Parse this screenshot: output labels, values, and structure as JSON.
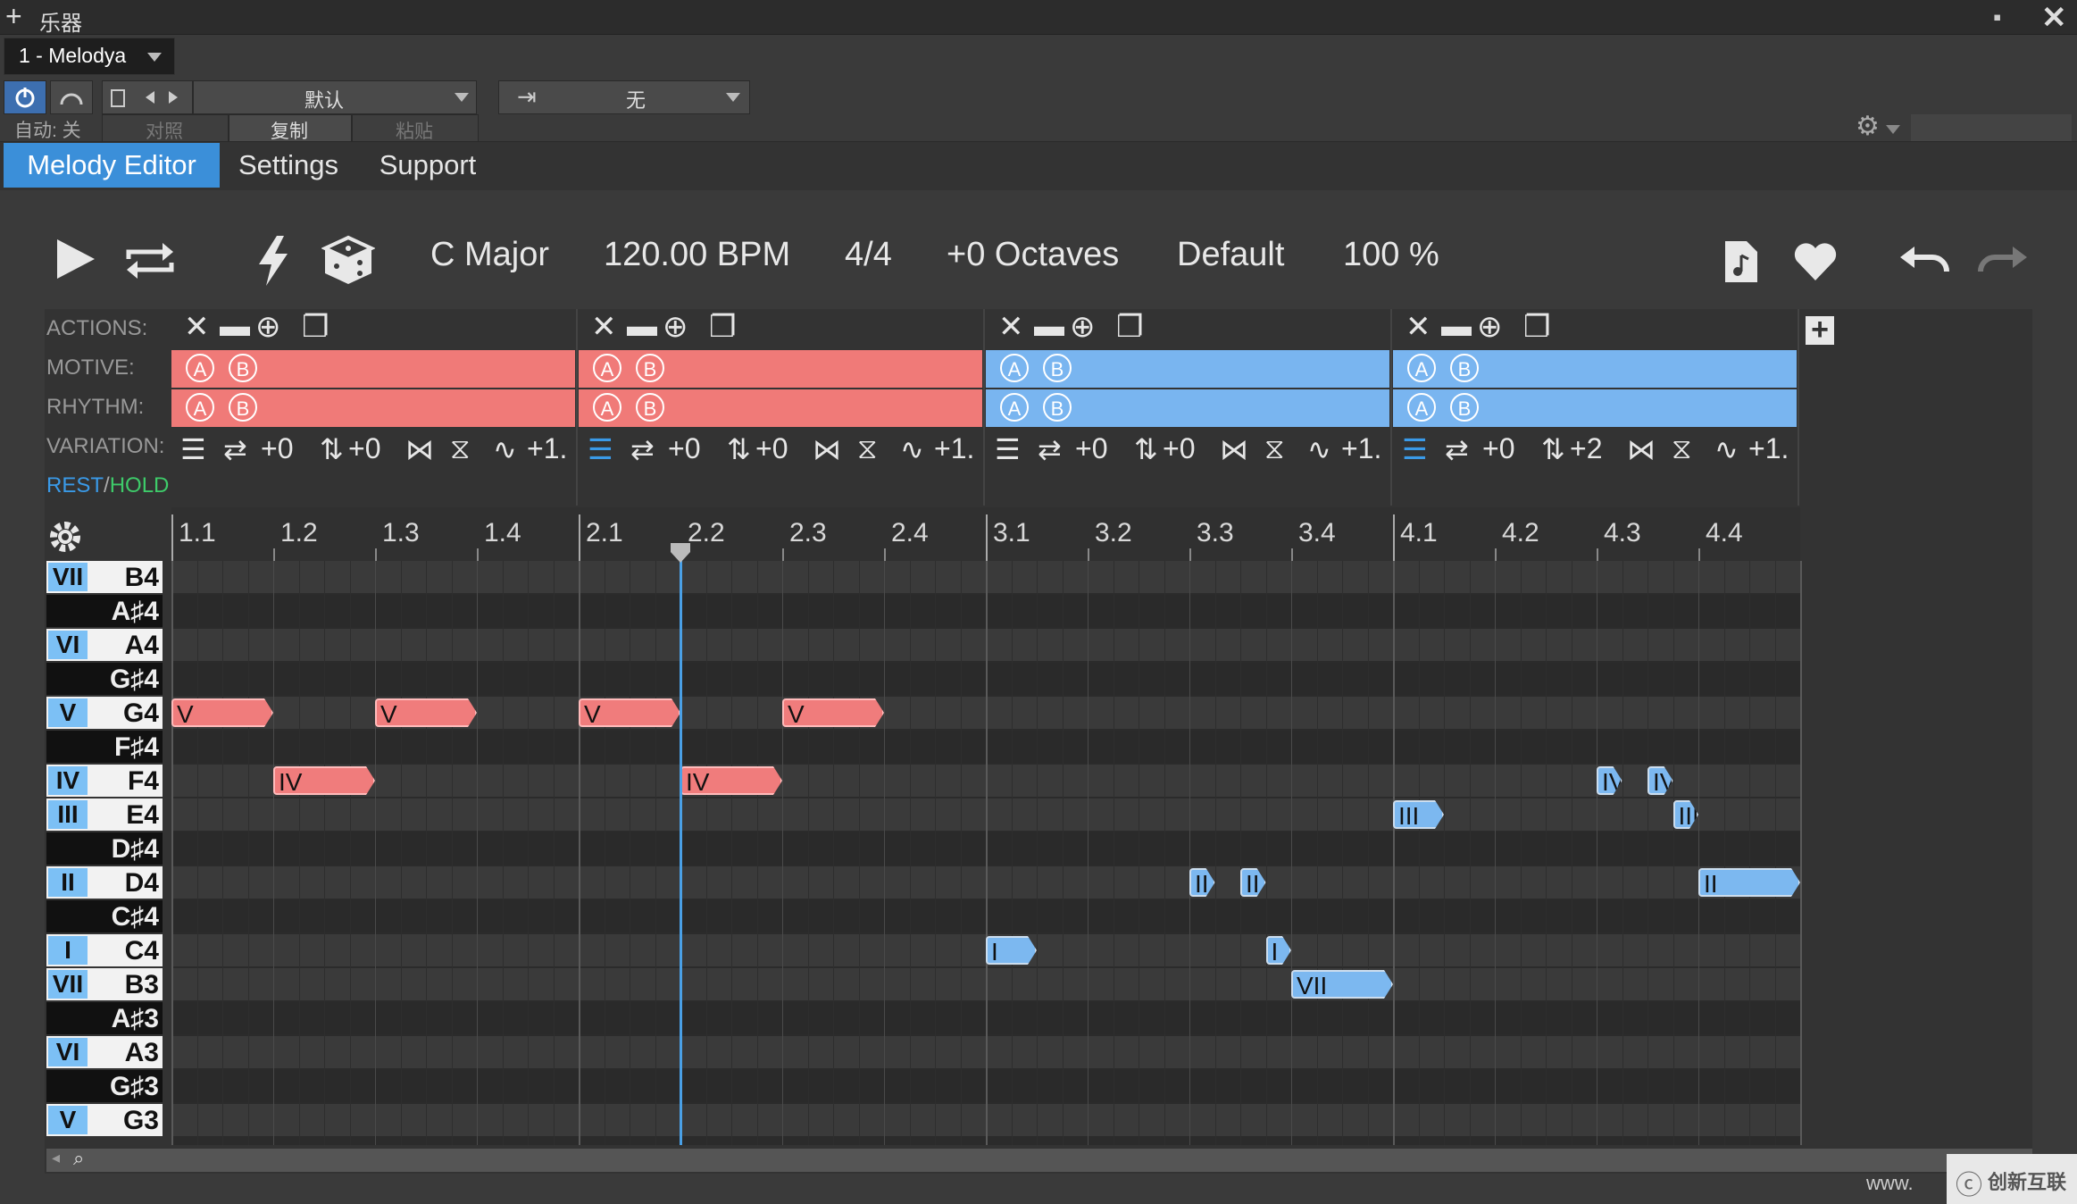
{
  "window": {
    "title": "乐器",
    "plus": "+",
    "pin": "▪",
    "close": "✕"
  },
  "instrument": {
    "name": "1 - Melodya"
  },
  "toolbar": {
    "preset": "默认",
    "routing": "无",
    "auto": "自动: 关",
    "compare": "对照",
    "copy": "复制",
    "paste": "粘贴"
  },
  "tabs": [
    {
      "label": "Melody Editor",
      "active": true
    },
    {
      "label": "Settings"
    },
    {
      "label": "Support"
    }
  ],
  "transport": {
    "key": "C Major",
    "bpm": "120.00 BPM",
    "time_sig": "4/4",
    "octaves": "+0 Octaves",
    "style": "Default",
    "zoom": "100 %"
  },
  "rows": {
    "actions": "ACTIONS:",
    "motive": "MOTIVE:",
    "rhythm": "RHYTHM:",
    "variation": "VARIATION:",
    "rest": "REST",
    "slash": "/",
    "hold": "HOLD"
  },
  "ab": {
    "a": "A",
    "b": "B"
  },
  "segments": [
    {
      "color": "#f07a78",
      "var": [
        "+0",
        "+0",
        "+1."
      ]
    },
    {
      "color": "#f07a78",
      "var": [
        "+0",
        "+0",
        "+1."
      ]
    },
    {
      "color": "#79b5f0",
      "var": [
        "+0",
        "+0",
        "+1."
      ]
    },
    {
      "color": "#79b5f0",
      "var": [
        "+0",
        "+2",
        "+1."
      ]
    }
  ],
  "ruler": [
    "1.1",
    "1.2",
    "1.3",
    "1.4",
    "2.1",
    "2.2",
    "2.3",
    "2.4",
    "3.1",
    "3.2",
    "3.3",
    "3.4",
    "4.1",
    "4.2",
    "4.3",
    "4.4"
  ],
  "keys": [
    {
      "deg": "VII",
      "note": "B4",
      "black": false
    },
    {
      "deg": "",
      "note": "A♯4",
      "black": true
    },
    {
      "deg": "VI",
      "note": "A4",
      "black": false
    },
    {
      "deg": "",
      "note": "G♯4",
      "black": true
    },
    {
      "deg": "V",
      "note": "G4",
      "black": false
    },
    {
      "deg": "",
      "note": "F♯4",
      "black": true
    },
    {
      "deg": "IV",
      "note": "F4",
      "black": false
    },
    {
      "deg": "III",
      "note": "E4",
      "black": false
    },
    {
      "deg": "",
      "note": "D♯4",
      "black": true
    },
    {
      "deg": "II",
      "note": "D4",
      "black": false
    },
    {
      "deg": "",
      "note": "C♯4",
      "black": true
    },
    {
      "deg": "I",
      "note": "C4",
      "black": false
    },
    {
      "deg": "VII",
      "note": "B3",
      "black": false
    },
    {
      "deg": "",
      "note": "A♯3",
      "black": true
    },
    {
      "deg": "VI",
      "note": "A3",
      "black": false
    },
    {
      "deg": "",
      "note": "G♯3",
      "black": true
    },
    {
      "deg": "V",
      "note": "G3",
      "black": false
    }
  ],
  "notes": [
    {
      "label": "V",
      "row": 4,
      "start": 0,
      "len": 4,
      "color": "red"
    },
    {
      "label": "V",
      "row": 4,
      "start": 8,
      "len": 4,
      "color": "red"
    },
    {
      "label": "V",
      "row": 4,
      "start": 16,
      "len": 4,
      "color": "red"
    },
    {
      "label": "V",
      "row": 4,
      "start": 24,
      "len": 4,
      "color": "red"
    },
    {
      "label": "IV",
      "row": 6,
      "start": 4,
      "len": 4,
      "color": "red"
    },
    {
      "label": "IV",
      "row": 6,
      "start": 20,
      "len": 4,
      "color": "red"
    },
    {
      "label": "I",
      "row": 11,
      "start": 32,
      "len": 2,
      "color": "blue"
    },
    {
      "label": "II",
      "row": 9,
      "start": 40,
      "len": 1,
      "color": "blue"
    },
    {
      "label": "II",
      "row": 9,
      "start": 42,
      "len": 1,
      "color": "blue"
    },
    {
      "label": "I",
      "row": 11,
      "start": 43,
      "len": 1,
      "color": "blue"
    },
    {
      "label": "VII",
      "row": 12,
      "start": 44,
      "len": 4,
      "color": "blue"
    },
    {
      "label": "III",
      "row": 7,
      "start": 48,
      "len": 2,
      "color": "blue"
    },
    {
      "label": "IV",
      "row": 6,
      "start": 56,
      "len": 1,
      "color": "blue"
    },
    {
      "label": "IV",
      "row": 6,
      "start": 58,
      "len": 1,
      "color": "blue"
    },
    {
      "label": "III",
      "row": 7,
      "start": 59,
      "len": 1,
      "color": "blue"
    },
    {
      "label": "II",
      "row": 9,
      "start": 60,
      "len": 4,
      "color": "blue"
    }
  ],
  "playhead_position": 2.25,
  "watermark": {
    "left": "www.",
    "brand": "创新互联"
  }
}
